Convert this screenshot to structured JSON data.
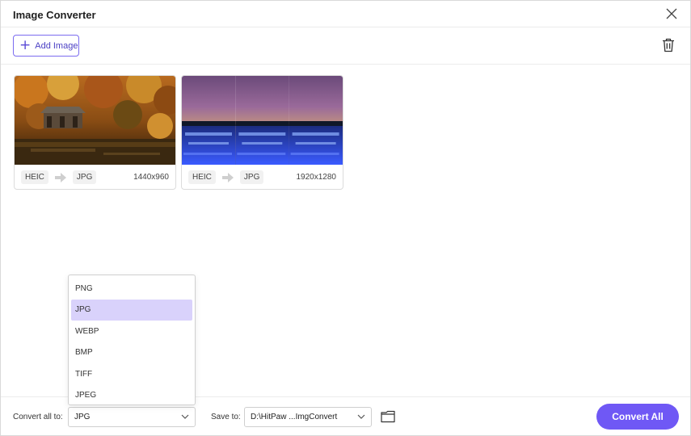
{
  "window": {
    "title": "Image Converter"
  },
  "toolbar": {
    "add_label": "Add Image"
  },
  "images": [
    {
      "from": "HEIC",
      "to": "JPG",
      "size": "1440x960"
    },
    {
      "from": "HEIC",
      "to": "JPG",
      "size": "1920x1280"
    }
  ],
  "format_menu": {
    "options": [
      "PNG",
      "JPG",
      "WEBP",
      "BMP",
      "TIFF",
      "JPEG"
    ],
    "selected": "JPG"
  },
  "bottom": {
    "convert_all_label": "Convert all to:",
    "convert_all_value": "JPG",
    "save_label": "Save to:",
    "save_path": "D:\\HitPaw ...ImgConvert",
    "convert_button": "Convert All"
  },
  "colors": {
    "accent": "#6f58f5",
    "accent_light": "#d9d2fb"
  }
}
